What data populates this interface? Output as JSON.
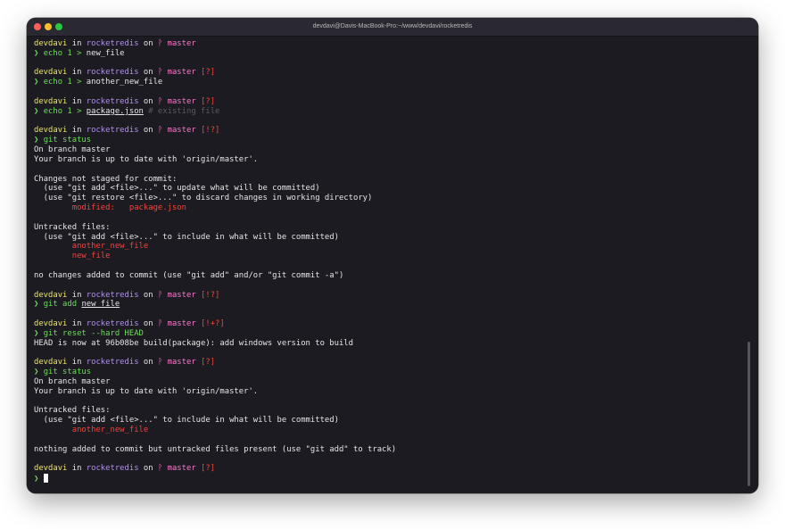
{
  "window": {
    "title": "devdavi@Davis-MacBook-Pro:~/www/devdavi/rocketredis"
  },
  "icons": {
    "close": "traffic-light-close",
    "minimize": "traffic-light-minimize",
    "maximize": "traffic-light-maximize",
    "branch": "git-branch-icon",
    "prompt": "chevron-right"
  },
  "colors": {
    "background": "#1c1b22",
    "user": "#e8e36f",
    "directory": "#b48ef0",
    "branch": "#f47cc8",
    "status": "#f0453c",
    "command": "#6fdc5a",
    "comment": "#5a5962"
  },
  "terminal": {
    "user": "devdavi",
    "in_word": "in",
    "dir": "rocketredis",
    "on_word": "on",
    "branch_icon": "ᚹ",
    "branch": "master",
    "prompt_arrow": "❯",
    "lines": [
      {
        "type": "prompt",
        "status": ""
      },
      {
        "type": "cmd",
        "parts": [
          {
            "t": "echo 1 > ",
            "c": "cmd"
          },
          {
            "t": "new_file",
            "c": "plain"
          }
        ]
      },
      {
        "type": "blank"
      },
      {
        "type": "prompt",
        "status": "[?]"
      },
      {
        "type": "cmd",
        "parts": [
          {
            "t": "echo 1 > ",
            "c": "cmd"
          },
          {
            "t": "another_new_file",
            "c": "plain"
          }
        ]
      },
      {
        "type": "blank"
      },
      {
        "type": "prompt",
        "status": "[?]"
      },
      {
        "type": "cmd",
        "parts": [
          {
            "t": "echo 1 > ",
            "c": "cmd"
          },
          {
            "t": "package.json",
            "c": "plain-u"
          },
          {
            "t": " # existing file",
            "c": "comment"
          }
        ]
      },
      {
        "type": "blank"
      },
      {
        "type": "prompt",
        "status": "[!?]"
      },
      {
        "type": "cmd",
        "parts": [
          {
            "t": "git status",
            "c": "cmd"
          }
        ]
      },
      {
        "type": "out",
        "text": "On branch master"
      },
      {
        "type": "out",
        "text": "Your branch is up to date with 'origin/master'."
      },
      {
        "type": "blank"
      },
      {
        "type": "out",
        "text": "Changes not staged for commit:"
      },
      {
        "type": "out",
        "text": "  (use \"git add <file>...\" to update what will be committed)"
      },
      {
        "type": "out",
        "text": "  (use \"git restore <file>...\" to discard changes in working directory)"
      },
      {
        "type": "red",
        "text": "        modified:   package.json"
      },
      {
        "type": "blank"
      },
      {
        "type": "out",
        "text": "Untracked files:"
      },
      {
        "type": "out",
        "text": "  (use \"git add <file>...\" to include in what will be committed)"
      },
      {
        "type": "red",
        "text": "        another_new_file"
      },
      {
        "type": "red",
        "text": "        new_file"
      },
      {
        "type": "blank"
      },
      {
        "type": "out",
        "text": "no changes added to commit (use \"git add\" and/or \"git commit -a\")"
      },
      {
        "type": "blank"
      },
      {
        "type": "prompt",
        "status": "[!?]"
      },
      {
        "type": "cmd",
        "parts": [
          {
            "t": "git add ",
            "c": "cmd"
          },
          {
            "t": "new_file",
            "c": "plain-u"
          }
        ]
      },
      {
        "type": "blank"
      },
      {
        "type": "prompt",
        "status": "[!+?]"
      },
      {
        "type": "cmd",
        "parts": [
          {
            "t": "git reset --hard HEAD",
            "c": "cmd"
          }
        ]
      },
      {
        "type": "out",
        "text": "HEAD is now at 96b08be build(package): add windows version to build"
      },
      {
        "type": "blank"
      },
      {
        "type": "prompt",
        "status": "[?]"
      },
      {
        "type": "cmd",
        "parts": [
          {
            "t": "git status",
            "c": "cmd"
          }
        ]
      },
      {
        "type": "out",
        "text": "On branch master"
      },
      {
        "type": "out",
        "text": "Your branch is up to date with 'origin/master'."
      },
      {
        "type": "blank"
      },
      {
        "type": "out",
        "text": "Untracked files:"
      },
      {
        "type": "out",
        "text": "  (use \"git add <file>...\" to include in what will be committed)"
      },
      {
        "type": "red",
        "text": "        another_new_file"
      },
      {
        "type": "blank"
      },
      {
        "type": "out",
        "text": "nothing added to commit but untracked files present (use \"git add\" to track)"
      },
      {
        "type": "blank"
      },
      {
        "type": "prompt",
        "status": "[?]"
      },
      {
        "type": "input"
      }
    ]
  }
}
